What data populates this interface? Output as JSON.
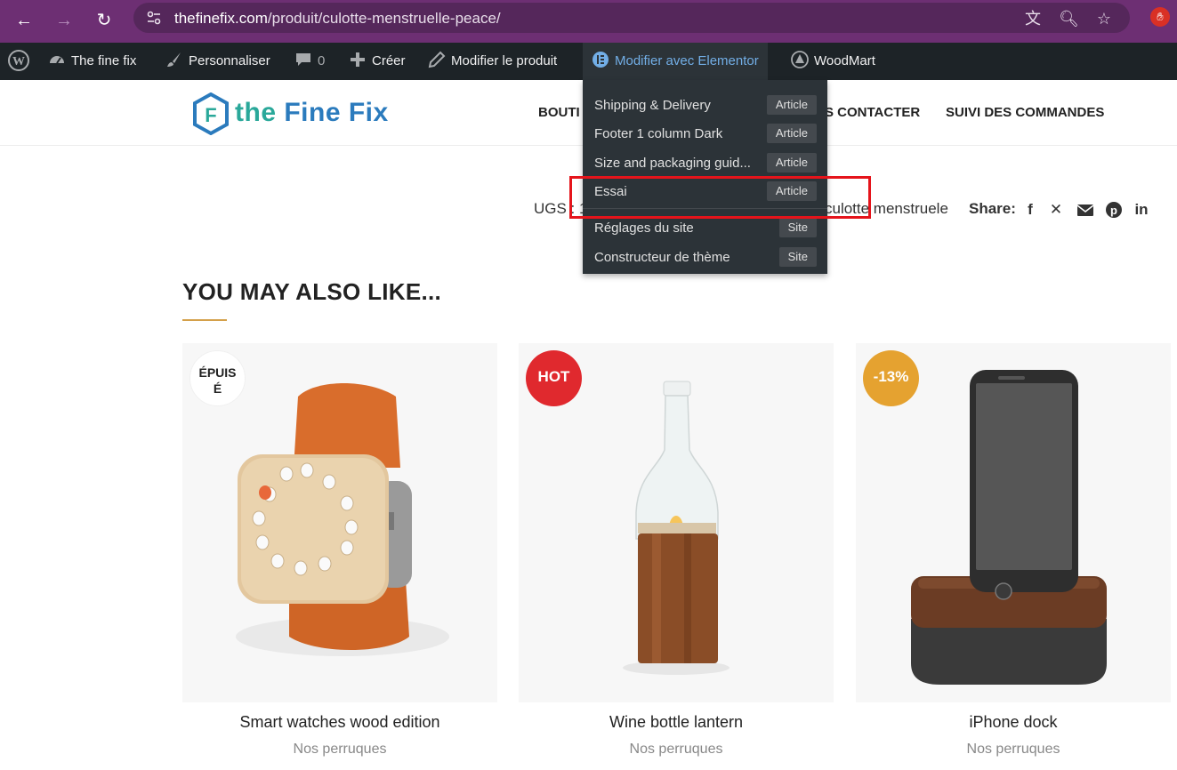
{
  "browser": {
    "url_domain": "thefinefix.com",
    "url_path": "/produit/culotte-menstruelle-peace/"
  },
  "adminbar": {
    "site_name": "The fine fix",
    "customize": "Personnaliser",
    "comments_count": "0",
    "create": "Créer",
    "edit_product": "Modifier le produit",
    "elementor": "Modifier avec Elementor",
    "woodmart": "WoodMart"
  },
  "elementor_menu": {
    "items": [
      {
        "label": "Shipping & Delivery",
        "badge": "Article"
      },
      {
        "label": "Footer 1 column Dark",
        "badge": "Article"
      },
      {
        "label": "Size and packaging guid...",
        "badge": "Article"
      },
      {
        "label": "Essai",
        "badge": "Article"
      },
      {
        "label": "Réglages du site",
        "badge": "Site"
      },
      {
        "label": "Constructeur de thème",
        "badge": "Site"
      }
    ]
  },
  "header": {
    "logo_text_a": "the ",
    "logo_text_b": "Fine Fix",
    "logo_letter": "F",
    "menu": [
      "BOUTI",
      "S CONTACTER",
      "SUIVI DES COMMANDES"
    ]
  },
  "product_meta": {
    "sku_label": "UGS : 1",
    "tag_text": "culotte menstruele",
    "share_label": "Share:",
    "share_icons": [
      "facebook-icon",
      "x-icon",
      "email-icon",
      "pinterest-icon",
      "linkedin-icon"
    ]
  },
  "related": {
    "title": "YOU MAY ALSO LIKE...",
    "products": [
      {
        "name": "Smart watches wood edition",
        "category": "Nos perruques",
        "badge": "ÉPUIS É",
        "badge_color": "#ffffff"
      },
      {
        "name": "Wine bottle lantern",
        "category": "Nos perruques",
        "badge": "HOT",
        "badge_color": "#e0292e"
      },
      {
        "name": "iPhone dock",
        "category": "Nos perruques",
        "badge": "-13%",
        "badge_color": "#e5a230"
      }
    ]
  },
  "colors": {
    "browser_chrome": "#6d2f73",
    "wp_adminbar": "#1d2327",
    "accent_gold": "#d4a04a",
    "highlight_red": "#e5141b"
  }
}
